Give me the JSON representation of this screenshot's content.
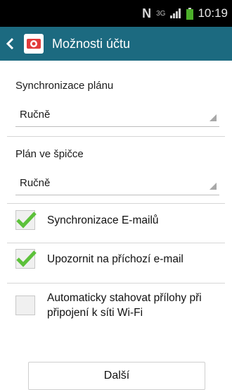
{
  "status_bar": {
    "nfc_label": "N",
    "network_label": "3G",
    "time": "10:19"
  },
  "header": {
    "title": "Možnosti účtu"
  },
  "sync_schedule": {
    "label": "Synchronizace plánu",
    "value": "Ručně"
  },
  "peak_schedule": {
    "label": "Plán ve špičce",
    "value": "Ručně"
  },
  "options": [
    {
      "label": "Synchronizace E-mailů",
      "checked": true
    },
    {
      "label": "Upozornit na příchozí e-mail",
      "checked": true
    },
    {
      "label": "Automaticky stahovat přílohy při připojení k síti Wi-Fi",
      "checked": false
    }
  ],
  "next_button": {
    "label": "Další"
  },
  "colors": {
    "action_bar": "#1c6a80",
    "check_green": "#5cc13a",
    "battery_green": "#4caf2a"
  }
}
